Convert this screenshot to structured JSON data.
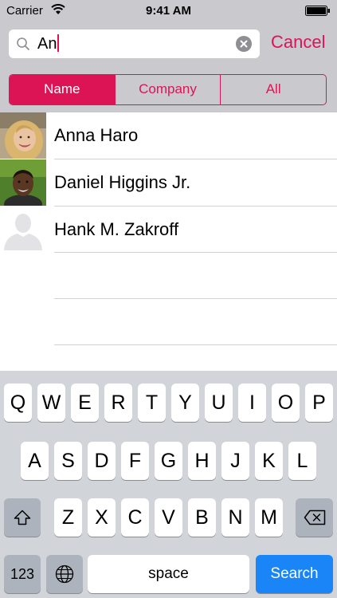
{
  "status_bar": {
    "carrier": "Carrier",
    "time": "9:41 AM"
  },
  "search": {
    "value": "An",
    "cancel_label": "Cancel"
  },
  "segments": {
    "items": [
      "Name",
      "Company",
      "All"
    ],
    "selected": "Name"
  },
  "contacts": [
    {
      "name": "Anna Haro",
      "avatar": "photo"
    },
    {
      "name": "Daniel Higgins Jr.",
      "avatar": "photo"
    },
    {
      "name": "Hank M. Zakroff",
      "avatar": "placeholder"
    }
  ],
  "keyboard": {
    "row1": [
      "Q",
      "W",
      "E",
      "R",
      "T",
      "Y",
      "U",
      "I",
      "O",
      "P"
    ],
    "row2": [
      "A",
      "S",
      "D",
      "F",
      "G",
      "H",
      "J",
      "K",
      "L"
    ],
    "row3": [
      "Z",
      "X",
      "C",
      "V",
      "B",
      "N",
      "M"
    ],
    "numbers_label": "123",
    "space_label": "space",
    "search_label": "Search"
  },
  "colors": {
    "accent": "#dc1456",
    "search_key": "#1a85f6",
    "header_bg": "#c9c9ce",
    "keyboard_bg": "#d1d4d9"
  }
}
